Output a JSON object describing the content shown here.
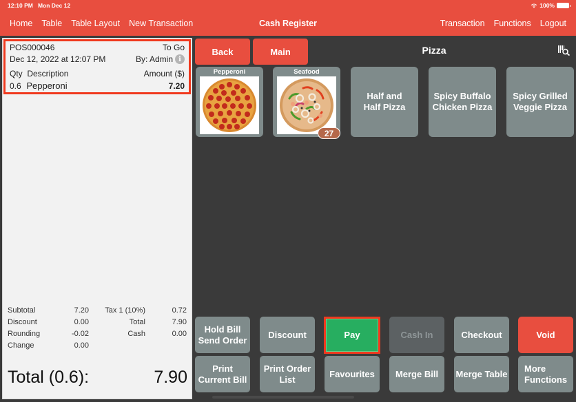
{
  "status_bar": {
    "time": "12:10 PM",
    "date": "Mon Dec 12",
    "battery": "100%"
  },
  "nav": {
    "left": [
      "Home",
      "Table",
      "Table Layout",
      "New Transaction"
    ],
    "title": "Cash Register",
    "right": [
      "Transaction",
      "Functions",
      "Logout"
    ]
  },
  "receipt": {
    "order_no": "POS000046",
    "order_type": "To Go",
    "datetime": "Dec 12, 2022 at 12:07 PM",
    "by": "By: Admin",
    "headers": {
      "qty": "Qty",
      "description": "Description",
      "amount": "Amount ($)"
    },
    "items": [
      {
        "qty": "0.6",
        "description": "Pepperoni",
        "amount": "7.20"
      }
    ],
    "totals": [
      {
        "label": "Subtotal",
        "value": "7.20",
        "label2": "Tax 1 (10%)",
        "value2": "0.72"
      },
      {
        "label": "Discount",
        "value": "0.00",
        "label2": "Total",
        "value2": "7.90"
      },
      {
        "label": "Rounding",
        "value": "-0.02",
        "label2": "Cash",
        "value2": "0.00"
      },
      {
        "label": "Change",
        "value": "0.00",
        "label2": "",
        "value2": ""
      }
    ],
    "grand_total_label": "Total (0.6):",
    "grand_total_value": "7.90"
  },
  "menu": {
    "back_label": "Back",
    "main_label": "Main",
    "category_title": "Pizza",
    "items": [
      {
        "label": "Pepperoni",
        "image": "pepperoni-pizza",
        "badge": ""
      },
      {
        "label": "Seafood",
        "image": "seafood-pizza",
        "badge": "27"
      },
      {
        "label": "Half and Half Pizza"
      },
      {
        "label": "Spicy Buffalo Chicken Pizza"
      },
      {
        "label": "Spicy Grilled Veggie Pizza"
      }
    ]
  },
  "functions": {
    "row1": [
      "Hold Bill Send Order",
      "Discount",
      "Pay",
      "Cash In",
      "Checkout",
      "Void"
    ],
    "row2": [
      "Print Current Bill",
      "Print Order List",
      "Favourites",
      "Merge Bill",
      "Merge Table",
      "More Functions"
    ]
  },
  "colors": {
    "brand_red": "#e84e3f",
    "pay_green": "#27ae60",
    "tile_gray": "#7f8b8b",
    "highlight": "#f0391e"
  }
}
